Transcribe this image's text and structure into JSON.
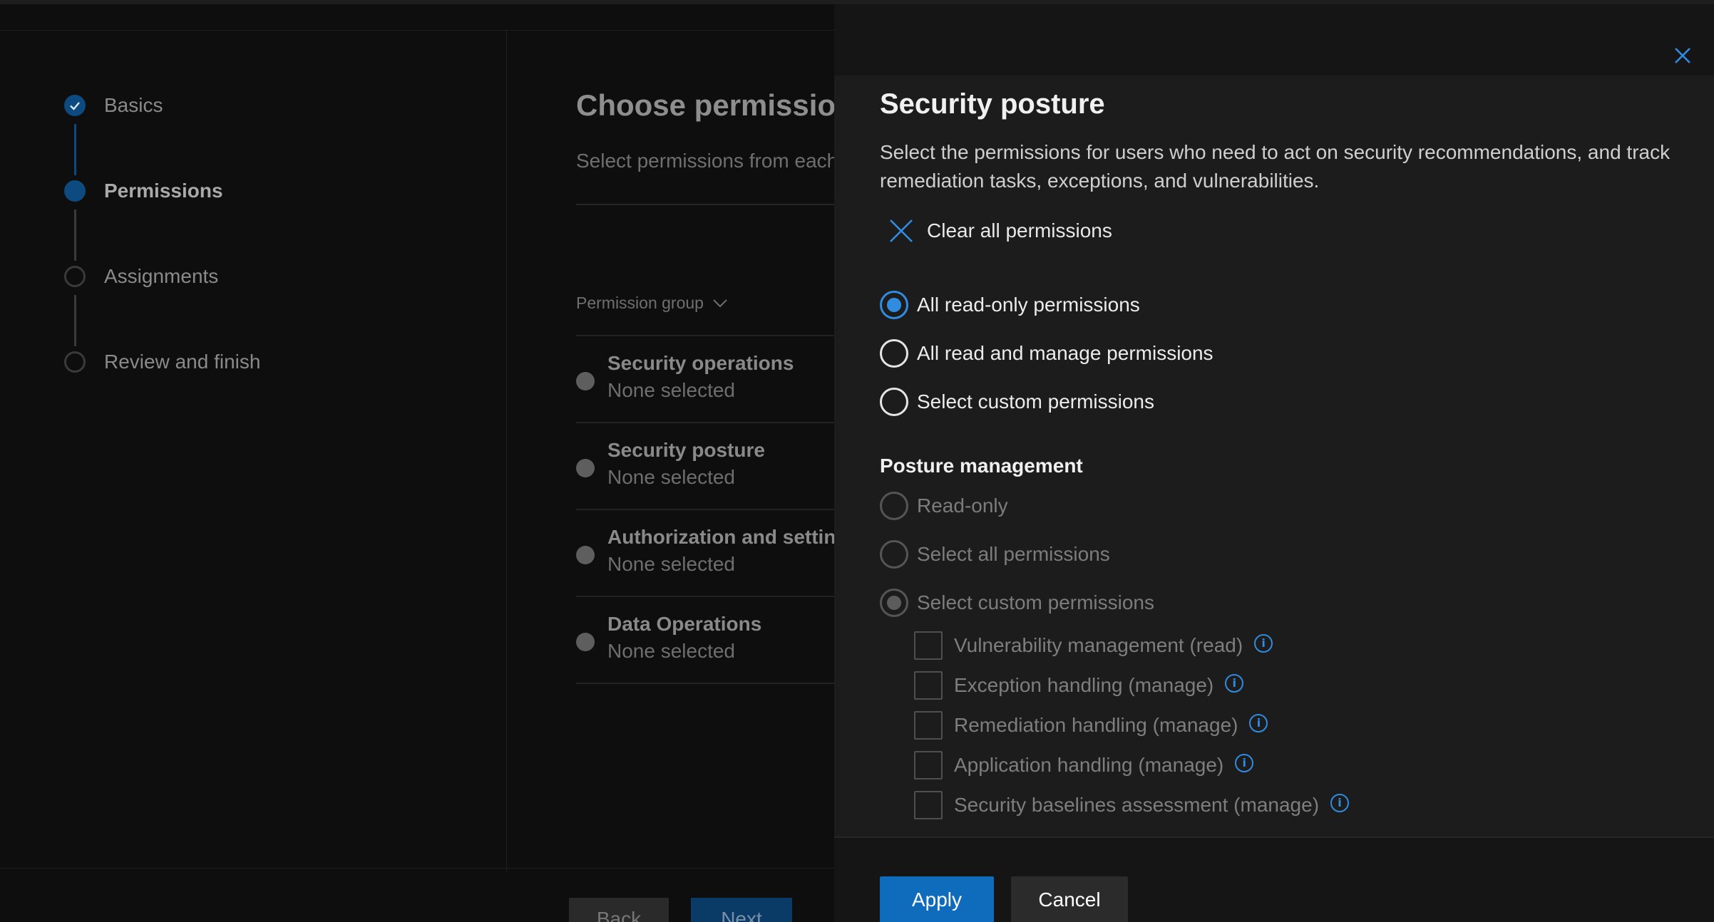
{
  "wizard": {
    "steps": [
      {
        "label": "Basics",
        "state": "done"
      },
      {
        "label": "Permissions",
        "state": "current"
      },
      {
        "label": "Assignments",
        "state": "todo"
      },
      {
        "label": "Review and finish",
        "state": "todo"
      }
    ],
    "title": "Choose permission",
    "subtitle": "Select permissions from each",
    "permission_group_header": "Permission group",
    "permission_groups": [
      {
        "name": "Security operations",
        "value": "None selected"
      },
      {
        "name": "Security posture",
        "value": "None selected"
      },
      {
        "name": "Authorization and setting",
        "value": "None selected"
      },
      {
        "name": "Data Operations",
        "value": "None selected"
      }
    ],
    "back_label": "Back",
    "next_label": "Next"
  },
  "panel": {
    "title": "Security posture",
    "description": "Select the permissions for users who need to act on security recommendations, and track remediation tasks, exceptions, and vulnerabilities.",
    "clear_all_label": "Clear all permissions",
    "scope_options": [
      {
        "label": "All read-only permissions",
        "selected": true
      },
      {
        "label": "All read and manage permissions",
        "selected": false
      },
      {
        "label": "Select custom permissions",
        "selected": false
      }
    ],
    "section_title": "Posture management",
    "section_options": [
      {
        "label": "Read-only",
        "selected": false,
        "disabled": true
      },
      {
        "label": "Select all permissions",
        "selected": false,
        "disabled": true
      },
      {
        "label": "Select custom permissions",
        "selected": true,
        "disabled": true
      }
    ],
    "custom_permissions": [
      {
        "label": "Vulnerability management (read)",
        "checked": false
      },
      {
        "label": "Exception handling (manage)",
        "checked": false
      },
      {
        "label": "Remediation handling (manage)",
        "checked": false
      },
      {
        "label": "Application handling (manage)",
        "checked": false
      },
      {
        "label": "Security baselines assessment (manage)",
        "checked": false
      }
    ],
    "apply_label": "Apply",
    "cancel_label": "Cancel"
  },
  "colors": {
    "accent": "#2f8ce0",
    "primary_button": "#0f6cbd",
    "panel_background": "#1c1c1c"
  }
}
